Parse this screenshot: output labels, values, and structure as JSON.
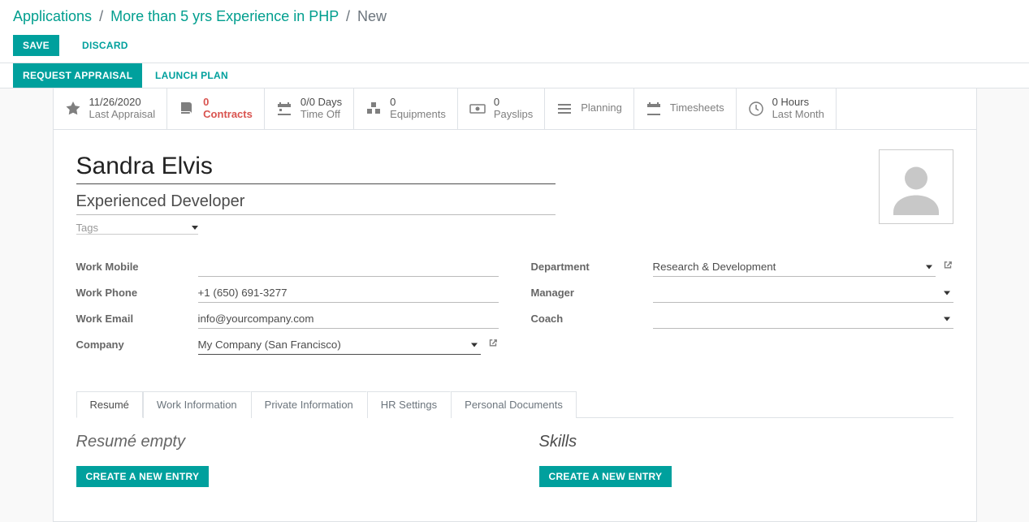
{
  "breadcrumb": {
    "level1": "Applications",
    "level2": "More than 5 yrs Experience in PHP",
    "current": "New"
  },
  "actions": {
    "save": "SAVE",
    "discard": "DISCARD",
    "request_appraisal": "REQUEST APPRAISAL",
    "launch_plan": "LAUNCH PLAN"
  },
  "stats": {
    "last_appraisal": {
      "value": "11/26/2020",
      "label": "Last Appraisal"
    },
    "contracts": {
      "value": "0",
      "label": "Contracts"
    },
    "time_off": {
      "value": "0/0 Days",
      "label": "Time Off"
    },
    "equipments": {
      "value": "0",
      "label": "Equipments"
    },
    "payslips": {
      "value": "0",
      "label": "Payslips"
    },
    "planning": {
      "label": "Planning"
    },
    "timesheets": {
      "label": "Timesheets"
    },
    "last_month": {
      "value": "0 Hours",
      "label": "Last Month"
    }
  },
  "employee": {
    "name": "Sandra Elvis",
    "title": "Experienced Developer",
    "tags_placeholder": "Tags"
  },
  "fields": {
    "work_mobile": {
      "label": "Work Mobile",
      "value": ""
    },
    "work_phone": {
      "label": "Work Phone",
      "value": "+1 (650) 691-3277"
    },
    "work_email": {
      "label": "Work Email",
      "value": "info@yourcompany.com"
    },
    "company": {
      "label": "Company",
      "value": "My Company (San Francisco)"
    },
    "department": {
      "label": "Department",
      "value": "Research & Development"
    },
    "manager": {
      "label": "Manager",
      "value": ""
    },
    "coach": {
      "label": "Coach",
      "value": ""
    }
  },
  "tabs": {
    "resume": "Resumé",
    "work_info": "Work Information",
    "private_info": "Private Information",
    "hr_settings": "HR Settings",
    "personal_docs": "Personal Documents"
  },
  "resume": {
    "title": "Resumé empty",
    "create": "CREATE A NEW ENTRY"
  },
  "skills": {
    "title": "Skills",
    "create": "CREATE A NEW ENTRY"
  }
}
